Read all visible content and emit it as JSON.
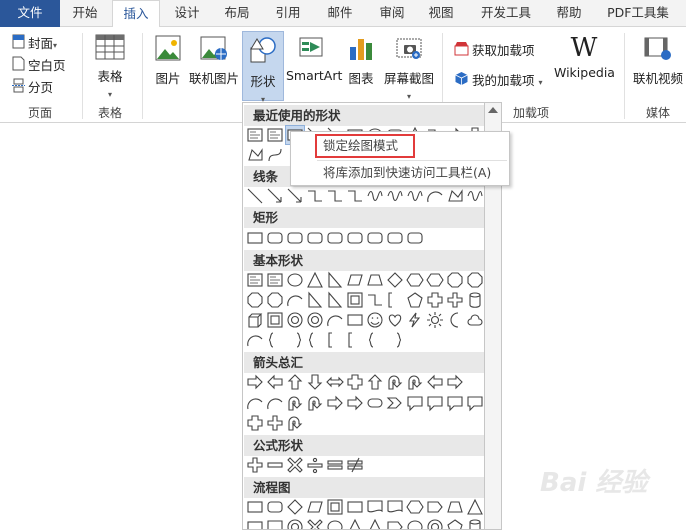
{
  "tabs": {
    "file": "文件",
    "home": "开始",
    "insert": "插入",
    "design": "设计",
    "layout": "布局",
    "references": "引用",
    "mailings": "邮件",
    "review": "审阅",
    "view": "视图",
    "developer": "开发工具",
    "help": "帮助",
    "pdf": "PDF工具集"
  },
  "ribbon": {
    "pages": {
      "cover": "封面",
      "blank": "空白页",
      "break": "分页",
      "label": "页面"
    },
    "tables": {
      "table": "表格",
      "label": "表格"
    },
    "illustrations": {
      "picture": "图片",
      "online_picture": "联机图片",
      "shapes": "形状",
      "smartart": "SmartArt",
      "chart": "图表",
      "screenshot": "屏幕截图"
    },
    "addins": {
      "get": "获取加载项",
      "my": "我的加载项",
      "wikipedia": "Wikipedia",
      "label": "加载项"
    },
    "media": {
      "online_video": "联机视频",
      "label": "媒体"
    }
  },
  "gallery": {
    "sections": [
      "最近使用的形状",
      "线条",
      "矩形",
      "基本形状",
      "箭头总汇",
      "公式形状",
      "流程图"
    ]
  },
  "context_menu": {
    "lock": "锁定绘图模式",
    "add_qat": "将库添加到快速访问工具栏(A)"
  },
  "watermark": "Bai 经验",
  "colors": {
    "file_tab": "#2b579a",
    "accent": "#2b579a",
    "highlight": "#e23b3b"
  }
}
